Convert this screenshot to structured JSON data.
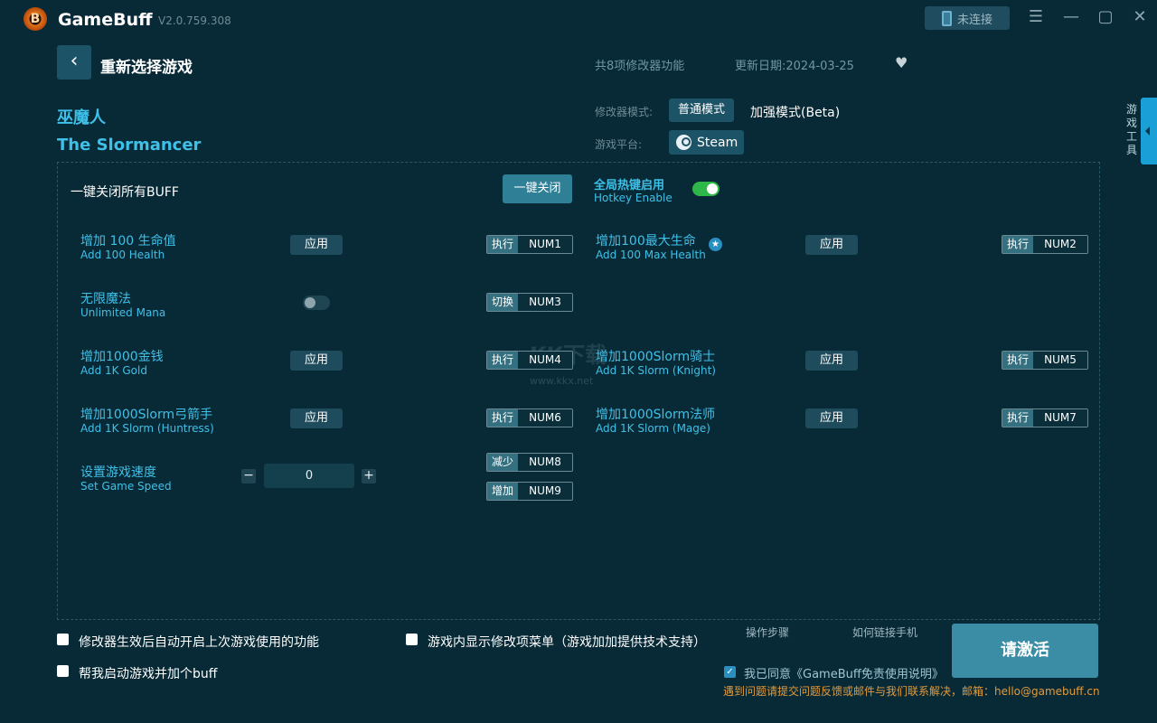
{
  "app": {
    "name": "GameBuff",
    "version": "V2.0.759.308",
    "logo_text": "B",
    "connect_label": "未连接"
  },
  "window_controls": {
    "menu": "☰",
    "minimize": "—",
    "maximize": "▢",
    "close": "✕"
  },
  "header": {
    "back_icon": "‹",
    "reselect_label": "重新选择游戏",
    "feature_count": "共8项修改器功能",
    "update_date": "更新日期:2024-03-25",
    "heart_icon": "♥"
  },
  "game": {
    "name_cn": "巫魔人",
    "name_en": "The Slormancer"
  },
  "modes": {
    "mode_label": "修改器模式:",
    "normal_mode": "普通模式",
    "enhanced_mode": "加强模式(Beta)",
    "platform_label": "游戏平台:",
    "platform": "Steam"
  },
  "side_tab": {
    "label": "游戏工具"
  },
  "panel": {
    "close_all_label": "一键关闭所有BUFF",
    "close_all_button": "一键关闭",
    "hotkey_cn": "全局热键启用",
    "hotkey_en": "Hotkey Enable",
    "hotkey_enabled": true
  },
  "features": [
    {
      "cn": "增加 100 生命值",
      "en": "Add 100 Health",
      "control": "应用",
      "action": "执行",
      "key": "NUM1"
    },
    {
      "cn": "增加100最大生命",
      "en": "Add 100 Max Health",
      "control": "应用",
      "action": "执行",
      "key": "NUM2",
      "badge": "★"
    },
    {
      "cn": "无限魔法",
      "en": "Unlimited Mana",
      "control": "toggle",
      "enabled": false,
      "action": "切换",
      "key": "NUM3"
    },
    {
      "cn": "增加1000金钱",
      "en": "Add 1K Gold",
      "control": "应用",
      "action": "执行",
      "key": "NUM4"
    },
    {
      "cn": "增加1000Slorm骑士",
      "en": "Add 1K Slorm (Knight)",
      "control": "应用",
      "action": "执行",
      "key": "NUM5"
    },
    {
      "cn": "增加1000Slorm弓箭手",
      "en": "Add 1K Slorm (Huntress)",
      "control": "应用",
      "action": "执行",
      "key": "NUM6"
    },
    {
      "cn": "增加1000Slorm法师",
      "en": "Add 1K Slorm (Mage)",
      "control": "应用",
      "action": "执行",
      "key": "NUM7"
    },
    {
      "cn": "设置游戏速度",
      "en": "Set Game Speed",
      "control": "stepper",
      "value": "0",
      "minus": "−",
      "plus": "+",
      "keys": [
        {
          "action": "减少",
          "key": "NUM8"
        },
        {
          "action": "增加",
          "key": "NUM9"
        }
      ]
    }
  ],
  "watermark": {
    "main": "KK下载",
    "url": "www.kkx.net"
  },
  "bottom": {
    "auto_enable_label": "修改器生效后自动开启上次游戏使用的功能",
    "auto_launch_label": "帮我启动游戏并加个buff",
    "in_game_menu_label": "游戏内显示修改项菜单（游戏加加提供技术支持）",
    "steps_link": "操作步骤",
    "phone_link": "如何链接手机",
    "activate_button": "请激活",
    "agree_label": "我已同意《GameBuff免责使用说明》",
    "agree_checked": true,
    "contact": "遇到问题请提交问题反馈或邮件与我们联系解决，邮箱：hello@gamebuff.cn"
  }
}
